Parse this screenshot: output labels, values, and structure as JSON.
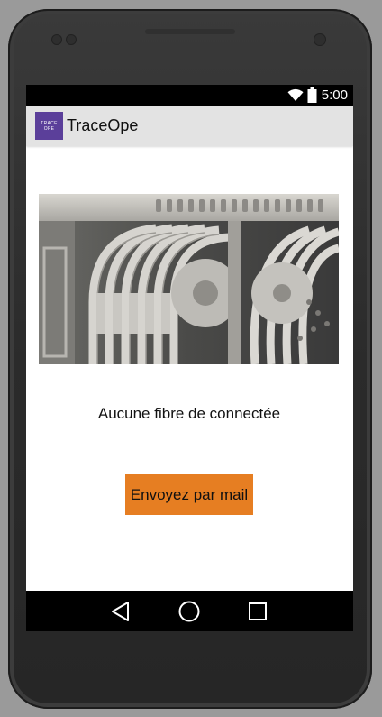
{
  "status_bar": {
    "time": "5:00",
    "icons": [
      "wifi-icon",
      "battery-icon"
    ]
  },
  "app_bar": {
    "logo_text": [
      "TRACE",
      "OPE"
    ],
    "title": "TraceOpe"
  },
  "main": {
    "image_subject": "fiber-splice-cassettes-photo",
    "status_text": "Aucune fibre de connectée",
    "mail_button_label": "Envoyez par mail"
  },
  "nav_bar": {
    "buttons": [
      "back-icon",
      "home-icon",
      "recents-icon"
    ]
  },
  "colors": {
    "button_accent": "#e67e22",
    "app_logo": "#5b3f9a",
    "app_bar_bg": "#e3e3e3"
  }
}
